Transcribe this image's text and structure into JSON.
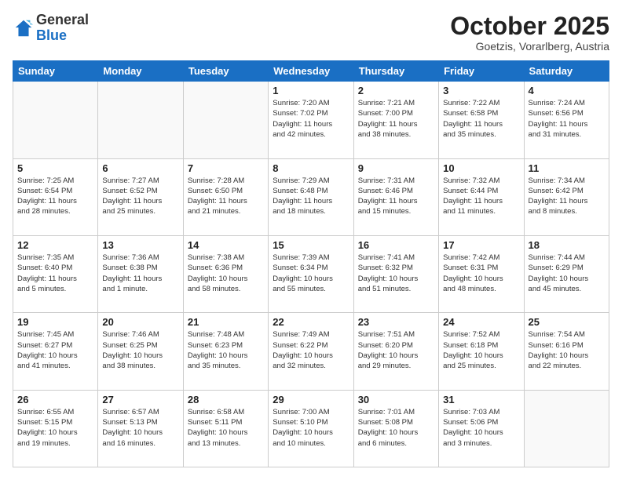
{
  "header": {
    "logo_line1": "General",
    "logo_line2": "Blue",
    "month": "October 2025",
    "location": "Goetzis, Vorarlberg, Austria"
  },
  "days_of_week": [
    "Sunday",
    "Monday",
    "Tuesday",
    "Wednesday",
    "Thursday",
    "Friday",
    "Saturday"
  ],
  "weeks": [
    [
      {
        "day": "",
        "info": ""
      },
      {
        "day": "",
        "info": ""
      },
      {
        "day": "",
        "info": ""
      },
      {
        "day": "1",
        "info": "Sunrise: 7:20 AM\nSunset: 7:02 PM\nDaylight: 11 hours\nand 42 minutes."
      },
      {
        "day": "2",
        "info": "Sunrise: 7:21 AM\nSunset: 7:00 PM\nDaylight: 11 hours\nand 38 minutes."
      },
      {
        "day": "3",
        "info": "Sunrise: 7:22 AM\nSunset: 6:58 PM\nDaylight: 11 hours\nand 35 minutes."
      },
      {
        "day": "4",
        "info": "Sunrise: 7:24 AM\nSunset: 6:56 PM\nDaylight: 11 hours\nand 31 minutes."
      }
    ],
    [
      {
        "day": "5",
        "info": "Sunrise: 7:25 AM\nSunset: 6:54 PM\nDaylight: 11 hours\nand 28 minutes."
      },
      {
        "day": "6",
        "info": "Sunrise: 7:27 AM\nSunset: 6:52 PM\nDaylight: 11 hours\nand 25 minutes."
      },
      {
        "day": "7",
        "info": "Sunrise: 7:28 AM\nSunset: 6:50 PM\nDaylight: 11 hours\nand 21 minutes."
      },
      {
        "day": "8",
        "info": "Sunrise: 7:29 AM\nSunset: 6:48 PM\nDaylight: 11 hours\nand 18 minutes."
      },
      {
        "day": "9",
        "info": "Sunrise: 7:31 AM\nSunset: 6:46 PM\nDaylight: 11 hours\nand 15 minutes."
      },
      {
        "day": "10",
        "info": "Sunrise: 7:32 AM\nSunset: 6:44 PM\nDaylight: 11 hours\nand 11 minutes."
      },
      {
        "day": "11",
        "info": "Sunrise: 7:34 AM\nSunset: 6:42 PM\nDaylight: 11 hours\nand 8 minutes."
      }
    ],
    [
      {
        "day": "12",
        "info": "Sunrise: 7:35 AM\nSunset: 6:40 PM\nDaylight: 11 hours\nand 5 minutes."
      },
      {
        "day": "13",
        "info": "Sunrise: 7:36 AM\nSunset: 6:38 PM\nDaylight: 11 hours\nand 1 minute."
      },
      {
        "day": "14",
        "info": "Sunrise: 7:38 AM\nSunset: 6:36 PM\nDaylight: 10 hours\nand 58 minutes."
      },
      {
        "day": "15",
        "info": "Sunrise: 7:39 AM\nSunset: 6:34 PM\nDaylight: 10 hours\nand 55 minutes."
      },
      {
        "day": "16",
        "info": "Sunrise: 7:41 AM\nSunset: 6:32 PM\nDaylight: 10 hours\nand 51 minutes."
      },
      {
        "day": "17",
        "info": "Sunrise: 7:42 AM\nSunset: 6:31 PM\nDaylight: 10 hours\nand 48 minutes."
      },
      {
        "day": "18",
        "info": "Sunrise: 7:44 AM\nSunset: 6:29 PM\nDaylight: 10 hours\nand 45 minutes."
      }
    ],
    [
      {
        "day": "19",
        "info": "Sunrise: 7:45 AM\nSunset: 6:27 PM\nDaylight: 10 hours\nand 41 minutes."
      },
      {
        "day": "20",
        "info": "Sunrise: 7:46 AM\nSunset: 6:25 PM\nDaylight: 10 hours\nand 38 minutes."
      },
      {
        "day": "21",
        "info": "Sunrise: 7:48 AM\nSunset: 6:23 PM\nDaylight: 10 hours\nand 35 minutes."
      },
      {
        "day": "22",
        "info": "Sunrise: 7:49 AM\nSunset: 6:22 PM\nDaylight: 10 hours\nand 32 minutes."
      },
      {
        "day": "23",
        "info": "Sunrise: 7:51 AM\nSunset: 6:20 PM\nDaylight: 10 hours\nand 29 minutes."
      },
      {
        "day": "24",
        "info": "Sunrise: 7:52 AM\nSunset: 6:18 PM\nDaylight: 10 hours\nand 25 minutes."
      },
      {
        "day": "25",
        "info": "Sunrise: 7:54 AM\nSunset: 6:16 PM\nDaylight: 10 hours\nand 22 minutes."
      }
    ],
    [
      {
        "day": "26",
        "info": "Sunrise: 6:55 AM\nSunset: 5:15 PM\nDaylight: 10 hours\nand 19 minutes."
      },
      {
        "day": "27",
        "info": "Sunrise: 6:57 AM\nSunset: 5:13 PM\nDaylight: 10 hours\nand 16 minutes."
      },
      {
        "day": "28",
        "info": "Sunrise: 6:58 AM\nSunset: 5:11 PM\nDaylight: 10 hours\nand 13 minutes."
      },
      {
        "day": "29",
        "info": "Sunrise: 7:00 AM\nSunset: 5:10 PM\nDaylight: 10 hours\nand 10 minutes."
      },
      {
        "day": "30",
        "info": "Sunrise: 7:01 AM\nSunset: 5:08 PM\nDaylight: 10 hours\nand 6 minutes."
      },
      {
        "day": "31",
        "info": "Sunrise: 7:03 AM\nSunset: 5:06 PM\nDaylight: 10 hours\nand 3 minutes."
      },
      {
        "day": "",
        "info": ""
      }
    ]
  ]
}
